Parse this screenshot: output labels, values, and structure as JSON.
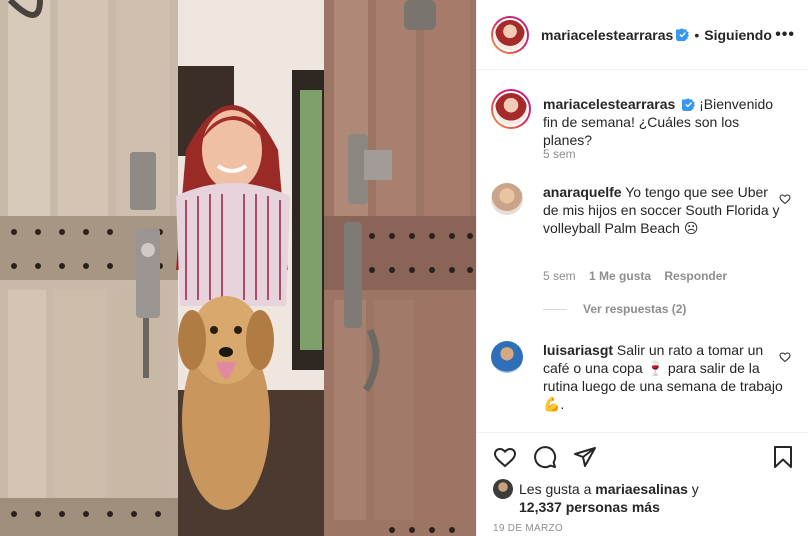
{
  "post_author": {
    "username": "mariacelestearraras",
    "follow_status": "Siguiendo",
    "separator": "•"
  },
  "caption": {
    "username": "mariacelestearraras",
    "text": "¡Bienvenido fin de semana! ¿Cuáles son los planes?",
    "time": "5 sem"
  },
  "comments": [
    {
      "username": "anaraquelfe",
      "text": "Yo tengo que see Uber de mis hijos en soccer South Florida y volleyball Palm Beach ☹",
      "time": "5 sem",
      "likes": "1 Me gusta",
      "reply_label": "Responder",
      "view_replies": "Ver respuestas (2)"
    },
    {
      "username": "luisariasgt",
      "text": "Salir un rato a tomar un café o una copa 🍷 para salir de la rutina luego de una semana de trabajo 💪.",
      "time": "",
      "likes": "",
      "reply_label": ""
    }
  ],
  "likes": {
    "prefix": "Les gusta a",
    "liked_by": "mariaesalinas",
    "joiner": "y",
    "others": "12,337 personas más"
  },
  "date": "19 DE MARZO",
  "icons": {
    "more": "more-options-icon",
    "like": "heart-icon",
    "comment": "comment-icon",
    "share": "share-icon",
    "save": "bookmark-icon",
    "verified": "verified-badge-icon"
  },
  "colors": {
    "verified_blue": "#3897f0",
    "text": "#262626",
    "secondary": "#8e8e8e",
    "border": "#efefef"
  }
}
